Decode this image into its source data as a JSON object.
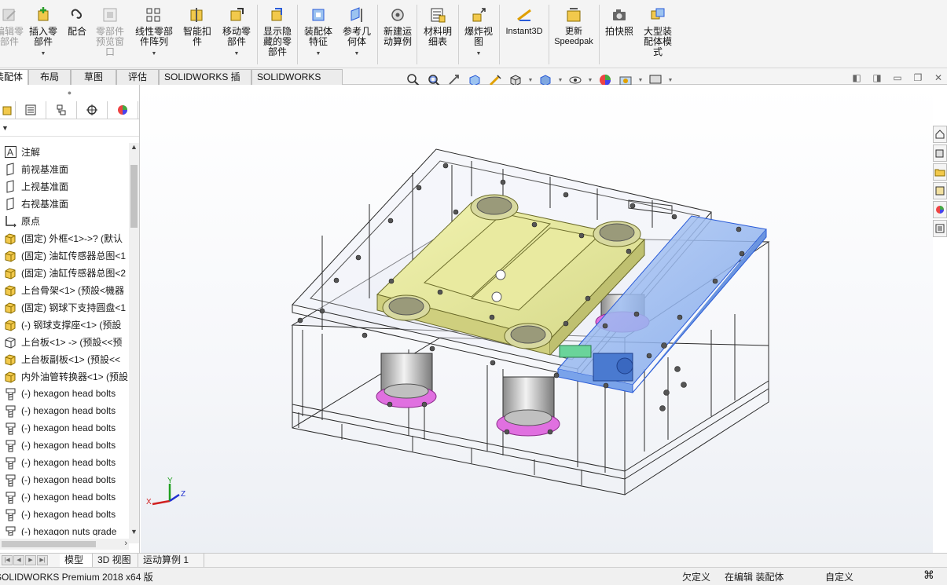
{
  "ribbon": {
    "items": [
      {
        "label": "编辑零\n部件",
        "disabled": true,
        "icon": "edit-component-icon"
      },
      {
        "label": "插入零\n部件",
        "disabled": false,
        "icon": "insert-component-icon",
        "dropdown": true
      },
      {
        "label": "配合",
        "disabled": false,
        "icon": "mate-icon"
      },
      {
        "label": "零部件\n预览窗\n口",
        "disabled": true,
        "icon": "component-preview-icon"
      },
      {
        "label": "线性零部\n件阵列",
        "disabled": false,
        "icon": "linear-pattern-icon",
        "dropdown": true
      },
      {
        "label": "智能扣\n件",
        "disabled": false,
        "icon": "smart-fasteners-icon"
      },
      {
        "label": "移动零\n部件",
        "disabled": false,
        "icon": "move-component-icon",
        "dropdown": true
      },
      {
        "label": "显示隐\n藏的零\n部件",
        "disabled": false,
        "icon": "show-hidden-icon"
      },
      {
        "label": "装配体\n特征",
        "disabled": false,
        "icon": "assembly-features-icon",
        "dropdown": true
      },
      {
        "label": "参考几\n何体",
        "disabled": false,
        "icon": "reference-geometry-icon",
        "dropdown": true
      },
      {
        "label": "新建运\n动算例",
        "disabled": false,
        "icon": "new-motion-study-icon"
      },
      {
        "label": "材料明\n细表",
        "disabled": false,
        "icon": "bill-of-materials-icon"
      },
      {
        "label": "爆炸视\n图",
        "disabled": false,
        "icon": "exploded-view-icon",
        "dropdown": true
      },
      {
        "label": "Instant3D",
        "disabled": false,
        "icon": "instant3d-icon"
      },
      {
        "label": "更新\nSpeedpak",
        "disabled": false,
        "icon": "speedpak-icon"
      },
      {
        "label": "拍快照",
        "disabled": false,
        "icon": "snapshot-icon"
      },
      {
        "label": "大型装\n配体模\n式",
        "disabled": false,
        "icon": "large-assembly-icon"
      }
    ]
  },
  "tabs": [
    "装配体",
    "布局",
    "草图",
    "评估",
    "SOLIDWORKS 插件",
    "SOLIDWORKS MBD"
  ],
  "active_tab": "装配体",
  "hud_icons": [
    "zoom-to-fit-icon",
    "zoom-area-icon",
    "previous-view-icon",
    "section-view-icon",
    "dynamic-annotation-icon",
    "view-orientation-icon",
    "display-style-icon",
    "hide-show-items-icon",
    "edit-appearance-icon",
    "apply-scene-icon",
    "view-settings-icon"
  ],
  "feature_tree": {
    "filter_label": "▼",
    "items": [
      {
        "icon": "annotations-icon",
        "label": "注解"
      },
      {
        "icon": "plane-icon",
        "label": "前视基准面"
      },
      {
        "icon": "plane-icon",
        "label": "上视基准面"
      },
      {
        "icon": "plane-icon",
        "label": "右视基准面"
      },
      {
        "icon": "origin-icon",
        "label": "原点"
      },
      {
        "icon": "subassembly-icon",
        "label": "(固定) 外框<1>->? (默认"
      },
      {
        "icon": "subassembly-icon",
        "label": "(固定) 油缸传感器总图<1"
      },
      {
        "icon": "subassembly-icon",
        "label": "(固定) 油缸传感器总图<2"
      },
      {
        "icon": "subassembly-icon",
        "label": "上台骨架<1> (预設<機器"
      },
      {
        "icon": "subassembly-icon",
        "label": "(固定) 钢球下支持圆盘<1"
      },
      {
        "icon": "subassembly-icon",
        "label": "(-) 钢球支撑座<1> (预設"
      },
      {
        "icon": "part-icon",
        "label": "上台板<1> -> (预設<<预"
      },
      {
        "icon": "subassembly-icon",
        "label": "上台板副板<1> (预設<<"
      },
      {
        "icon": "subassembly-icon",
        "label": "内外油管转换器<1> (预設"
      },
      {
        "icon": "bolt-icon",
        "label": "(-) hexagon head bolts"
      },
      {
        "icon": "bolt-icon",
        "label": "(-) hexagon head bolts"
      },
      {
        "icon": "bolt-icon",
        "label": "(-) hexagon head bolts"
      },
      {
        "icon": "bolt-icon",
        "label": "(-) hexagon head bolts"
      },
      {
        "icon": "bolt-icon",
        "label": "(-) hexagon head bolts"
      },
      {
        "icon": "bolt-icon",
        "label": "(-) hexagon head bolts"
      },
      {
        "icon": "bolt-icon",
        "label": "(-) hexagon head bolts"
      },
      {
        "icon": "bolt-icon",
        "label": "(-) hexagon head bolts"
      },
      {
        "icon": "bolt-icon",
        "label": "(-) hexagon nuts grade"
      }
    ]
  },
  "bottom_tabs": [
    "模型",
    "3D 视图",
    "运动算例 1"
  ],
  "active_bottom_tab": "模型",
  "status": {
    "app": "SOLIDWORKS Premium 2018 x64 版",
    "underdefined": "欠定义",
    "editing": "在编辑 装配体",
    "units": "自定义"
  },
  "triad": {
    "x": "X",
    "y": "Y",
    "z": "Z"
  },
  "colors": {
    "accent": "#1f5fbf",
    "plate": "#e4e59c",
    "pink": "#e070e0",
    "blue_plate": "#8fb4f0"
  }
}
